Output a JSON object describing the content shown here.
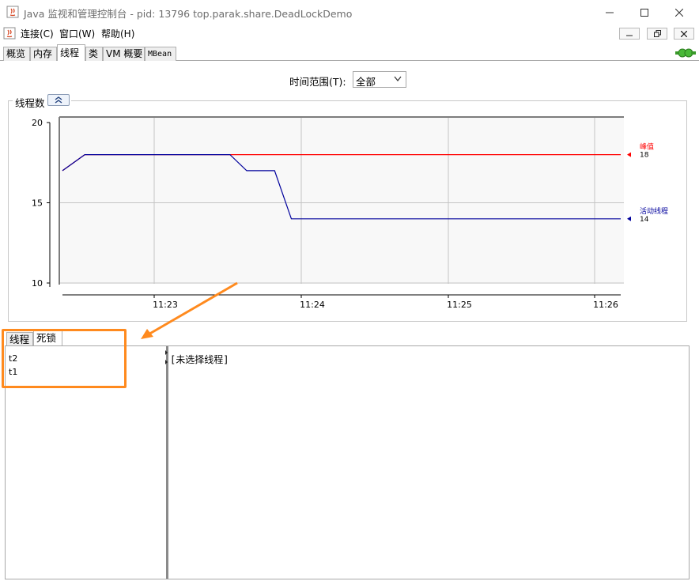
{
  "window": {
    "title": "Java 监视和管理控制台 - pid: 13796 top.parak.share.DeadLockDemo"
  },
  "menu": {
    "items": [
      "连接(C)",
      "窗口(W)",
      "帮助(H)"
    ]
  },
  "main_tabs": [
    "概览",
    "内存",
    "线程",
    "类",
    "VM 概要",
    "MBean"
  ],
  "main_tabs_active": "线程",
  "time_range": {
    "label": "时间范围(T):",
    "selected": "全部"
  },
  "chart_title": "线程数",
  "chart_data": {
    "type": "line",
    "y_ticks": [
      "20",
      "15",
      "10"
    ],
    "x_ticks": [
      "11:23",
      "11:24",
      "11:25",
      "11:26"
    ],
    "ylim": [
      10,
      20
    ],
    "grid": true,
    "series": [
      {
        "name": "峰值",
        "color": "#ff0000",
        "value_label": "18",
        "points": [
          [
            0.0,
            17
          ],
          [
            0.04,
            18
          ],
          [
            1.0,
            18
          ]
        ]
      },
      {
        "name": "活动线程",
        "color": "#00009c",
        "value_label": "14",
        "points": [
          [
            0.0,
            17
          ],
          [
            0.04,
            18
          ],
          [
            0.3,
            18
          ],
          [
            0.33,
            17
          ],
          [
            0.38,
            17
          ],
          [
            0.41,
            14
          ],
          [
            1.0,
            14
          ]
        ]
      }
    ]
  },
  "lower_tabs": [
    "线程",
    "死锁"
  ],
  "lower_tabs_active": "死锁",
  "deadlock_threads": [
    "t2",
    "t1"
  ],
  "detail_placeholder": "[未选择线程]",
  "colors": {
    "highlight": "#ff8a1e",
    "peak": "#ff0000",
    "live": "#00009c"
  }
}
